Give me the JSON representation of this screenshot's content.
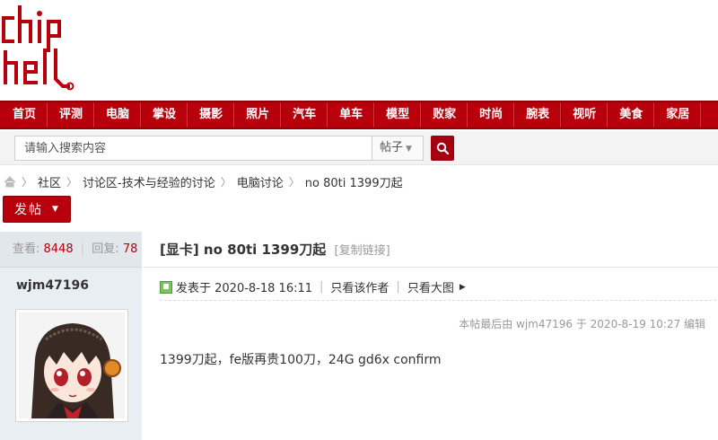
{
  "logo": {
    "text": "chiphell",
    "color": "#b7000c"
  },
  "nav": {
    "items": [
      "首页",
      "评测",
      "电脑",
      "掌设",
      "摄影",
      "照片",
      "汽车",
      "单车",
      "模型",
      "败家",
      "时尚",
      "腕表",
      "视听",
      "美食",
      "家居"
    ]
  },
  "search": {
    "placeholder": "请输入搜索内容",
    "type_label": "帖子",
    "button_icon": "search-icon"
  },
  "breadcrumb": {
    "home_icon": "home-icon",
    "items": [
      "社区",
      "讨论区-技术与经验的讨论",
      "电脑讨论",
      "no 80ti 1399刀起"
    ]
  },
  "post_button": {
    "label": "发帖"
  },
  "thread": {
    "views_label": "查看:",
    "views": "8448",
    "replies_label": "回复:",
    "replies": "78",
    "title": "[显卡] no 80ti 1399刀起",
    "copy_link": "[复制链接]"
  },
  "post": {
    "author": "wjm47196",
    "posted": "发表于 2020-8-18 16:11",
    "only_author": "只看该作者",
    "large_image": "只看大图",
    "edit_note": "本帖最后由 wjm47196 于 2020-8-19 10:27 编辑",
    "content": "1399刀起，fe版再贵100刀，24G gd6x confirm"
  },
  "colors": {
    "brand": "#b7000c",
    "sidebar": "#e9eef2"
  }
}
